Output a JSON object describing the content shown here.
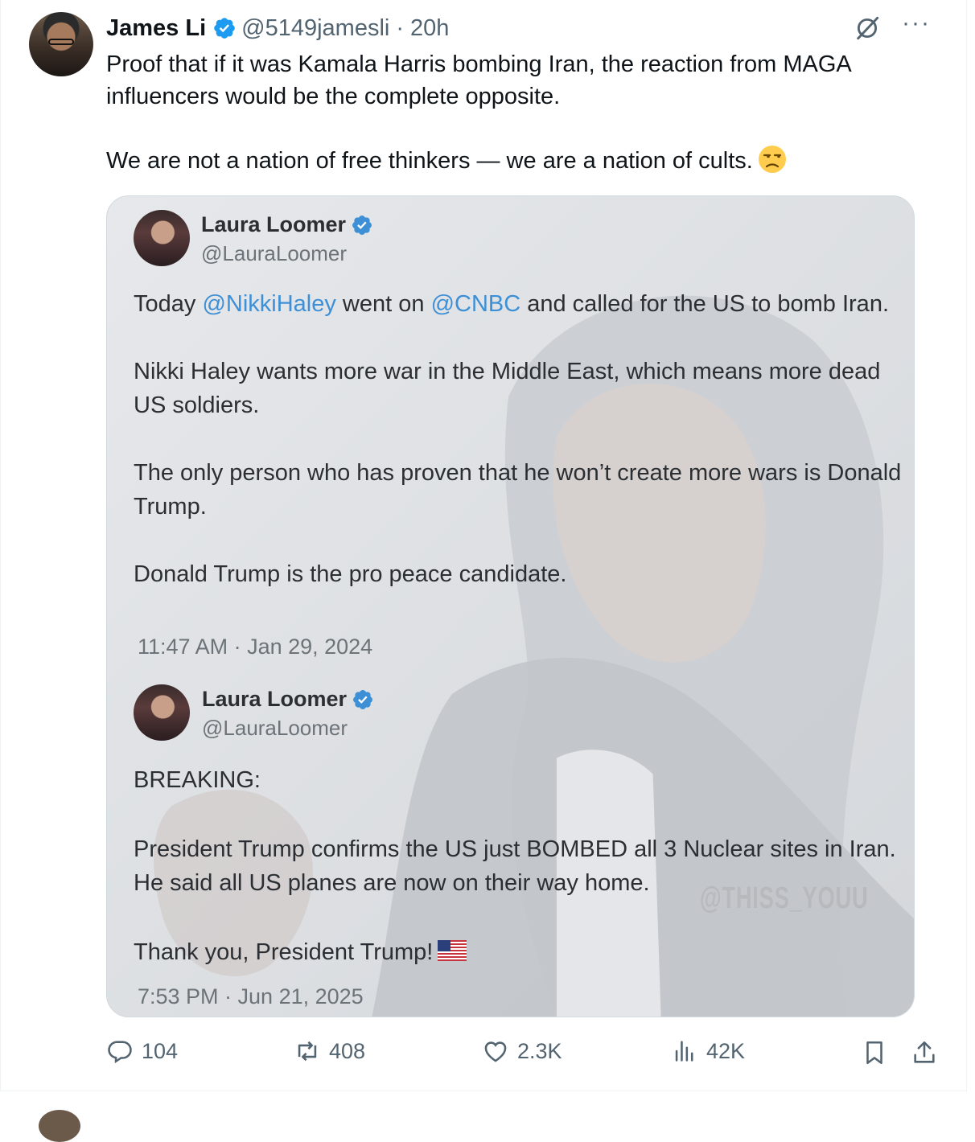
{
  "post": {
    "author_name": "James Li",
    "author_handle": "@5149jamesli",
    "separator": "·",
    "time_ago": "20h",
    "more_label": "···",
    "text_line1": "Proof that if it was Kamala Harris bombing Iran, the reaction from MAGA influencers would be the complete opposite.",
    "text_line2": "We are not a nation of free thinkers — we are a nation of cults.",
    "emoji_icon": "unamused-face-icon"
  },
  "media": {
    "watermark": "@THISS_YOUU",
    "quote1": {
      "author_name": "Laura Loomer",
      "author_handle": "@LauraLoomer",
      "p1_pre": "Today ",
      "p1_mention1": "@NikkiHaley",
      "p1_mid": " went on ",
      "p1_mention2": "@CNBC",
      "p1_post": " and called for the US to bomb Iran.",
      "p2": "Nikki Haley wants more war in the Middle East, which means more dead US soldiers.",
      "p3": "The only person who has proven that he won’t create more wars is Donald Trump.",
      "p4": "Donald Trump is the pro peace candidate.",
      "timestamp": "11:47 AM · Jan 29, 2024"
    },
    "quote2": {
      "author_name": "Laura Loomer",
      "author_handle": "@LauraLoomer",
      "p1": "BREAKING:",
      "p2": "President Trump confirms the US just BOMBED all 3 Nuclear sites in Iran. He said all US planes are now on their way home.",
      "p3": "Thank you, President Trump!",
      "flag_icon": "us-flag-icon",
      "timestamp": "7:53 PM · Jun 21, 2025"
    }
  },
  "actions": {
    "replies": "104",
    "reposts": "408",
    "likes": "2.3K",
    "views": "42K"
  },
  "colors": {
    "verified": "#1d9bf0",
    "muted_text": "#536471",
    "mention": "#3d8fd6"
  }
}
